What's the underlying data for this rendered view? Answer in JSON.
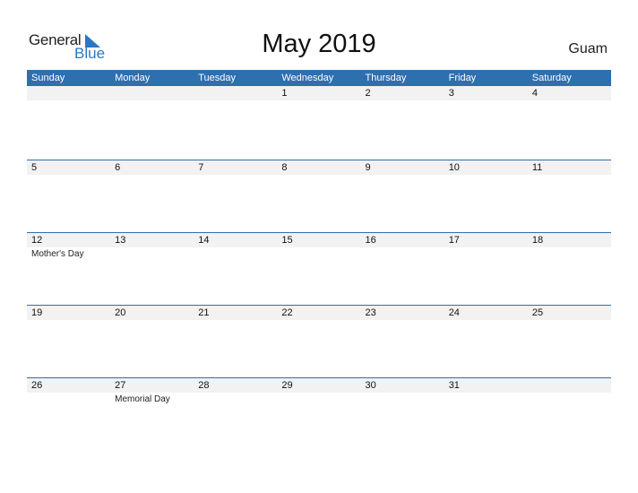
{
  "logo": {
    "general": "General",
    "blue": "Blue",
    "brand_color": "#2a78c2"
  },
  "title": "May 2019",
  "country": "Guam",
  "header_color": "#2e6fb0",
  "weekdays": [
    "Sunday",
    "Monday",
    "Tuesday",
    "Wednesday",
    "Thursday",
    "Friday",
    "Saturday"
  ],
  "weeks": [
    [
      {
        "date": ""
      },
      {
        "date": ""
      },
      {
        "date": ""
      },
      {
        "date": "1"
      },
      {
        "date": "2"
      },
      {
        "date": "3"
      },
      {
        "date": "4"
      }
    ],
    [
      {
        "date": "5"
      },
      {
        "date": "6"
      },
      {
        "date": "7"
      },
      {
        "date": "8"
      },
      {
        "date": "9"
      },
      {
        "date": "10"
      },
      {
        "date": "11"
      }
    ],
    [
      {
        "date": "12",
        "holiday": "Mother's Day"
      },
      {
        "date": "13"
      },
      {
        "date": "14"
      },
      {
        "date": "15"
      },
      {
        "date": "16"
      },
      {
        "date": "17"
      },
      {
        "date": "18"
      }
    ],
    [
      {
        "date": "19"
      },
      {
        "date": "20"
      },
      {
        "date": "21"
      },
      {
        "date": "22"
      },
      {
        "date": "23"
      },
      {
        "date": "24"
      },
      {
        "date": "25"
      }
    ],
    [
      {
        "date": "26"
      },
      {
        "date": "27",
        "holiday": "Memorial Day"
      },
      {
        "date": "28"
      },
      {
        "date": "29"
      },
      {
        "date": "30"
      },
      {
        "date": "31"
      },
      {
        "date": ""
      }
    ]
  ]
}
